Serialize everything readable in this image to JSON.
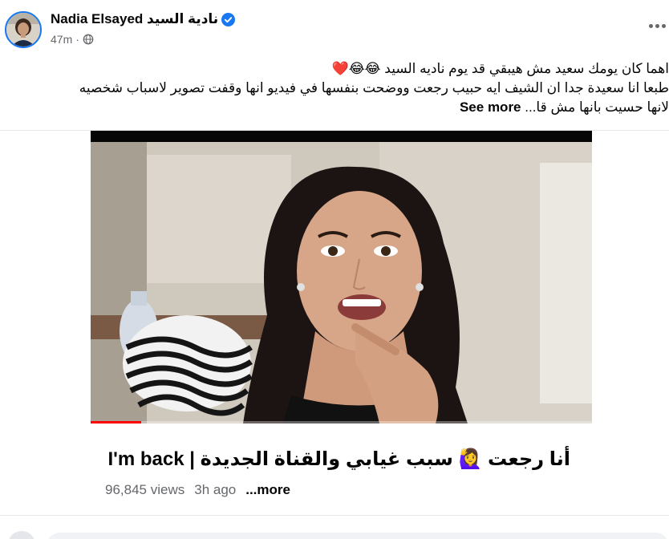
{
  "post": {
    "author_name": "Nadia Elsayed نادية السيد",
    "timestamp": "47m",
    "separator": "·",
    "audience_icon": "globe-icon",
    "more_icon": "more-options-icon",
    "verified_icon": "verified-badge-icon",
    "verified_color": "#1877f2"
  },
  "caption": {
    "line1": "اهما كان يومك سعيد مش هيبقي قد يوم ناديه السيد 😂😂❤️",
    "line2": "طبعا انا سعيدة جدا ان الشيف ايه حبيب رجعت ووضحت بنفسها في فيديو انها وقفت تصوير لاسباب شخصيه",
    "line3": "لانها حسيت بانها مش قا...",
    "see_more": "See more"
  },
  "video": {
    "thumbnail": "video-thumbnail-woman-smiling",
    "progress_fraction": 0.1,
    "progress_color": "#ff0000"
  },
  "link_card": {
    "title": "أنا رجعت 🙋‍♀️ سبب غيابي والقناة الجديدة | I'm back",
    "views": "96,845 views",
    "age": "3h ago",
    "more": "...more"
  }
}
